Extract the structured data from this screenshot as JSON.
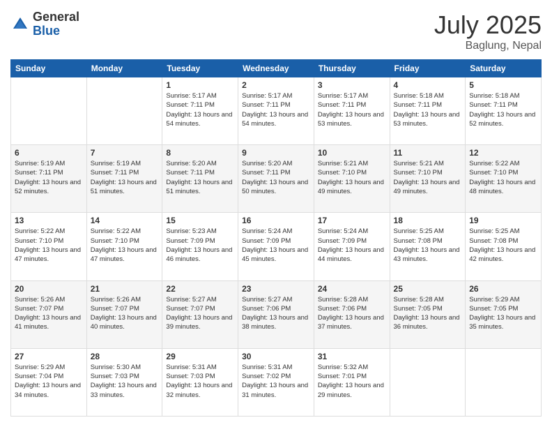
{
  "logo": {
    "general": "General",
    "blue": "Blue"
  },
  "header": {
    "month": "July 2025",
    "location": "Baglung, Nepal"
  },
  "weekdays": [
    "Sunday",
    "Monday",
    "Tuesday",
    "Wednesday",
    "Thursday",
    "Friday",
    "Saturday"
  ],
  "weeks": [
    [
      {
        "day": "",
        "sunrise": "",
        "sunset": "",
        "daylight": ""
      },
      {
        "day": "",
        "sunrise": "",
        "sunset": "",
        "daylight": ""
      },
      {
        "day": "1",
        "sunrise": "Sunrise: 5:17 AM",
        "sunset": "Sunset: 7:11 PM",
        "daylight": "Daylight: 13 hours and 54 minutes."
      },
      {
        "day": "2",
        "sunrise": "Sunrise: 5:17 AM",
        "sunset": "Sunset: 7:11 PM",
        "daylight": "Daylight: 13 hours and 54 minutes."
      },
      {
        "day": "3",
        "sunrise": "Sunrise: 5:17 AM",
        "sunset": "Sunset: 7:11 PM",
        "daylight": "Daylight: 13 hours and 53 minutes."
      },
      {
        "day": "4",
        "sunrise": "Sunrise: 5:18 AM",
        "sunset": "Sunset: 7:11 PM",
        "daylight": "Daylight: 13 hours and 53 minutes."
      },
      {
        "day": "5",
        "sunrise": "Sunrise: 5:18 AM",
        "sunset": "Sunset: 7:11 PM",
        "daylight": "Daylight: 13 hours and 52 minutes."
      }
    ],
    [
      {
        "day": "6",
        "sunrise": "Sunrise: 5:19 AM",
        "sunset": "Sunset: 7:11 PM",
        "daylight": "Daylight: 13 hours and 52 minutes."
      },
      {
        "day": "7",
        "sunrise": "Sunrise: 5:19 AM",
        "sunset": "Sunset: 7:11 PM",
        "daylight": "Daylight: 13 hours and 51 minutes."
      },
      {
        "day": "8",
        "sunrise": "Sunrise: 5:20 AM",
        "sunset": "Sunset: 7:11 PM",
        "daylight": "Daylight: 13 hours and 51 minutes."
      },
      {
        "day": "9",
        "sunrise": "Sunrise: 5:20 AM",
        "sunset": "Sunset: 7:11 PM",
        "daylight": "Daylight: 13 hours and 50 minutes."
      },
      {
        "day": "10",
        "sunrise": "Sunrise: 5:21 AM",
        "sunset": "Sunset: 7:10 PM",
        "daylight": "Daylight: 13 hours and 49 minutes."
      },
      {
        "day": "11",
        "sunrise": "Sunrise: 5:21 AM",
        "sunset": "Sunset: 7:10 PM",
        "daylight": "Daylight: 13 hours and 49 minutes."
      },
      {
        "day": "12",
        "sunrise": "Sunrise: 5:22 AM",
        "sunset": "Sunset: 7:10 PM",
        "daylight": "Daylight: 13 hours and 48 minutes."
      }
    ],
    [
      {
        "day": "13",
        "sunrise": "Sunrise: 5:22 AM",
        "sunset": "Sunset: 7:10 PM",
        "daylight": "Daylight: 13 hours and 47 minutes."
      },
      {
        "day": "14",
        "sunrise": "Sunrise: 5:22 AM",
        "sunset": "Sunset: 7:10 PM",
        "daylight": "Daylight: 13 hours and 47 minutes."
      },
      {
        "day": "15",
        "sunrise": "Sunrise: 5:23 AM",
        "sunset": "Sunset: 7:09 PM",
        "daylight": "Daylight: 13 hours and 46 minutes."
      },
      {
        "day": "16",
        "sunrise": "Sunrise: 5:24 AM",
        "sunset": "Sunset: 7:09 PM",
        "daylight": "Daylight: 13 hours and 45 minutes."
      },
      {
        "day": "17",
        "sunrise": "Sunrise: 5:24 AM",
        "sunset": "Sunset: 7:09 PM",
        "daylight": "Daylight: 13 hours and 44 minutes."
      },
      {
        "day": "18",
        "sunrise": "Sunrise: 5:25 AM",
        "sunset": "Sunset: 7:08 PM",
        "daylight": "Daylight: 13 hours and 43 minutes."
      },
      {
        "day": "19",
        "sunrise": "Sunrise: 5:25 AM",
        "sunset": "Sunset: 7:08 PM",
        "daylight": "Daylight: 13 hours and 42 minutes."
      }
    ],
    [
      {
        "day": "20",
        "sunrise": "Sunrise: 5:26 AM",
        "sunset": "Sunset: 7:07 PM",
        "daylight": "Daylight: 13 hours and 41 minutes."
      },
      {
        "day": "21",
        "sunrise": "Sunrise: 5:26 AM",
        "sunset": "Sunset: 7:07 PM",
        "daylight": "Daylight: 13 hours and 40 minutes."
      },
      {
        "day": "22",
        "sunrise": "Sunrise: 5:27 AM",
        "sunset": "Sunset: 7:07 PM",
        "daylight": "Daylight: 13 hours and 39 minutes."
      },
      {
        "day": "23",
        "sunrise": "Sunrise: 5:27 AM",
        "sunset": "Sunset: 7:06 PM",
        "daylight": "Daylight: 13 hours and 38 minutes."
      },
      {
        "day": "24",
        "sunrise": "Sunrise: 5:28 AM",
        "sunset": "Sunset: 7:06 PM",
        "daylight": "Daylight: 13 hours and 37 minutes."
      },
      {
        "day": "25",
        "sunrise": "Sunrise: 5:28 AM",
        "sunset": "Sunset: 7:05 PM",
        "daylight": "Daylight: 13 hours and 36 minutes."
      },
      {
        "day": "26",
        "sunrise": "Sunrise: 5:29 AM",
        "sunset": "Sunset: 7:05 PM",
        "daylight": "Daylight: 13 hours and 35 minutes."
      }
    ],
    [
      {
        "day": "27",
        "sunrise": "Sunrise: 5:29 AM",
        "sunset": "Sunset: 7:04 PM",
        "daylight": "Daylight: 13 hours and 34 minutes."
      },
      {
        "day": "28",
        "sunrise": "Sunrise: 5:30 AM",
        "sunset": "Sunset: 7:03 PM",
        "daylight": "Daylight: 13 hours and 33 minutes."
      },
      {
        "day": "29",
        "sunrise": "Sunrise: 5:31 AM",
        "sunset": "Sunset: 7:03 PM",
        "daylight": "Daylight: 13 hours and 32 minutes."
      },
      {
        "day": "30",
        "sunrise": "Sunrise: 5:31 AM",
        "sunset": "Sunset: 7:02 PM",
        "daylight": "Daylight: 13 hours and 31 minutes."
      },
      {
        "day": "31",
        "sunrise": "Sunrise: 5:32 AM",
        "sunset": "Sunset: 7:01 PM",
        "daylight": "Daylight: 13 hours and 29 minutes."
      },
      {
        "day": "",
        "sunrise": "",
        "sunset": "",
        "daylight": ""
      },
      {
        "day": "",
        "sunrise": "",
        "sunset": "",
        "daylight": ""
      }
    ]
  ]
}
